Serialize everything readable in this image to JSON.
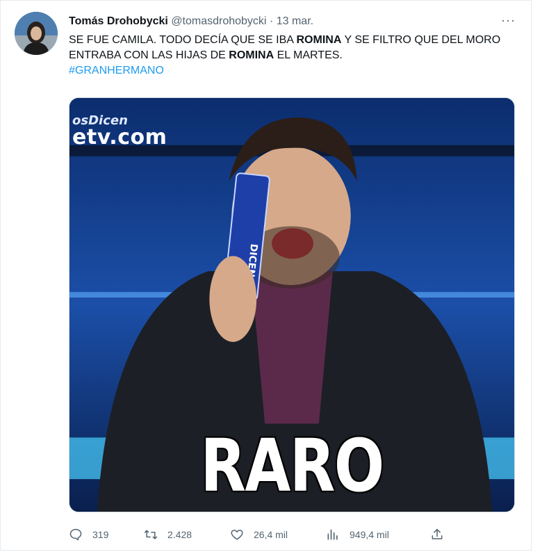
{
  "author": {
    "display_name": "Tomás Drohobycki",
    "handle": "@tomasdrohobycki",
    "separator": "·",
    "date": "13 mar."
  },
  "menu": {
    "more_label": "···"
  },
  "tweet": {
    "text_parts": [
      "SE FUE CAMILA. TODO DECÍA QUE SE IBA ",
      "ROMINA",
      " Y SE FILTRO QUE DEL MORO ENTRABA CON LAS HIJAS DE ",
      "ROMINA",
      " EL MARTES."
    ],
    "hashtag": "#GRANHERMANO"
  },
  "media": {
    "brand_top": "osDicen",
    "brand_bottom": "etv.com",
    "card_text": "DICEN",
    "caption": "RARO"
  },
  "actions": {
    "replies": "319",
    "retweets": "2.428",
    "likes": "26,4 mil",
    "views": "949,4 mil"
  },
  "icons": {
    "reply": "reply-icon",
    "retweet": "retweet-icon",
    "like": "heart-icon",
    "views": "views-bar-chart-icon",
    "share": "share-icon"
  },
  "colors": {
    "link": "#1d9bf0",
    "secondary_text": "#536471",
    "studio_blue": "#0d2a63"
  }
}
